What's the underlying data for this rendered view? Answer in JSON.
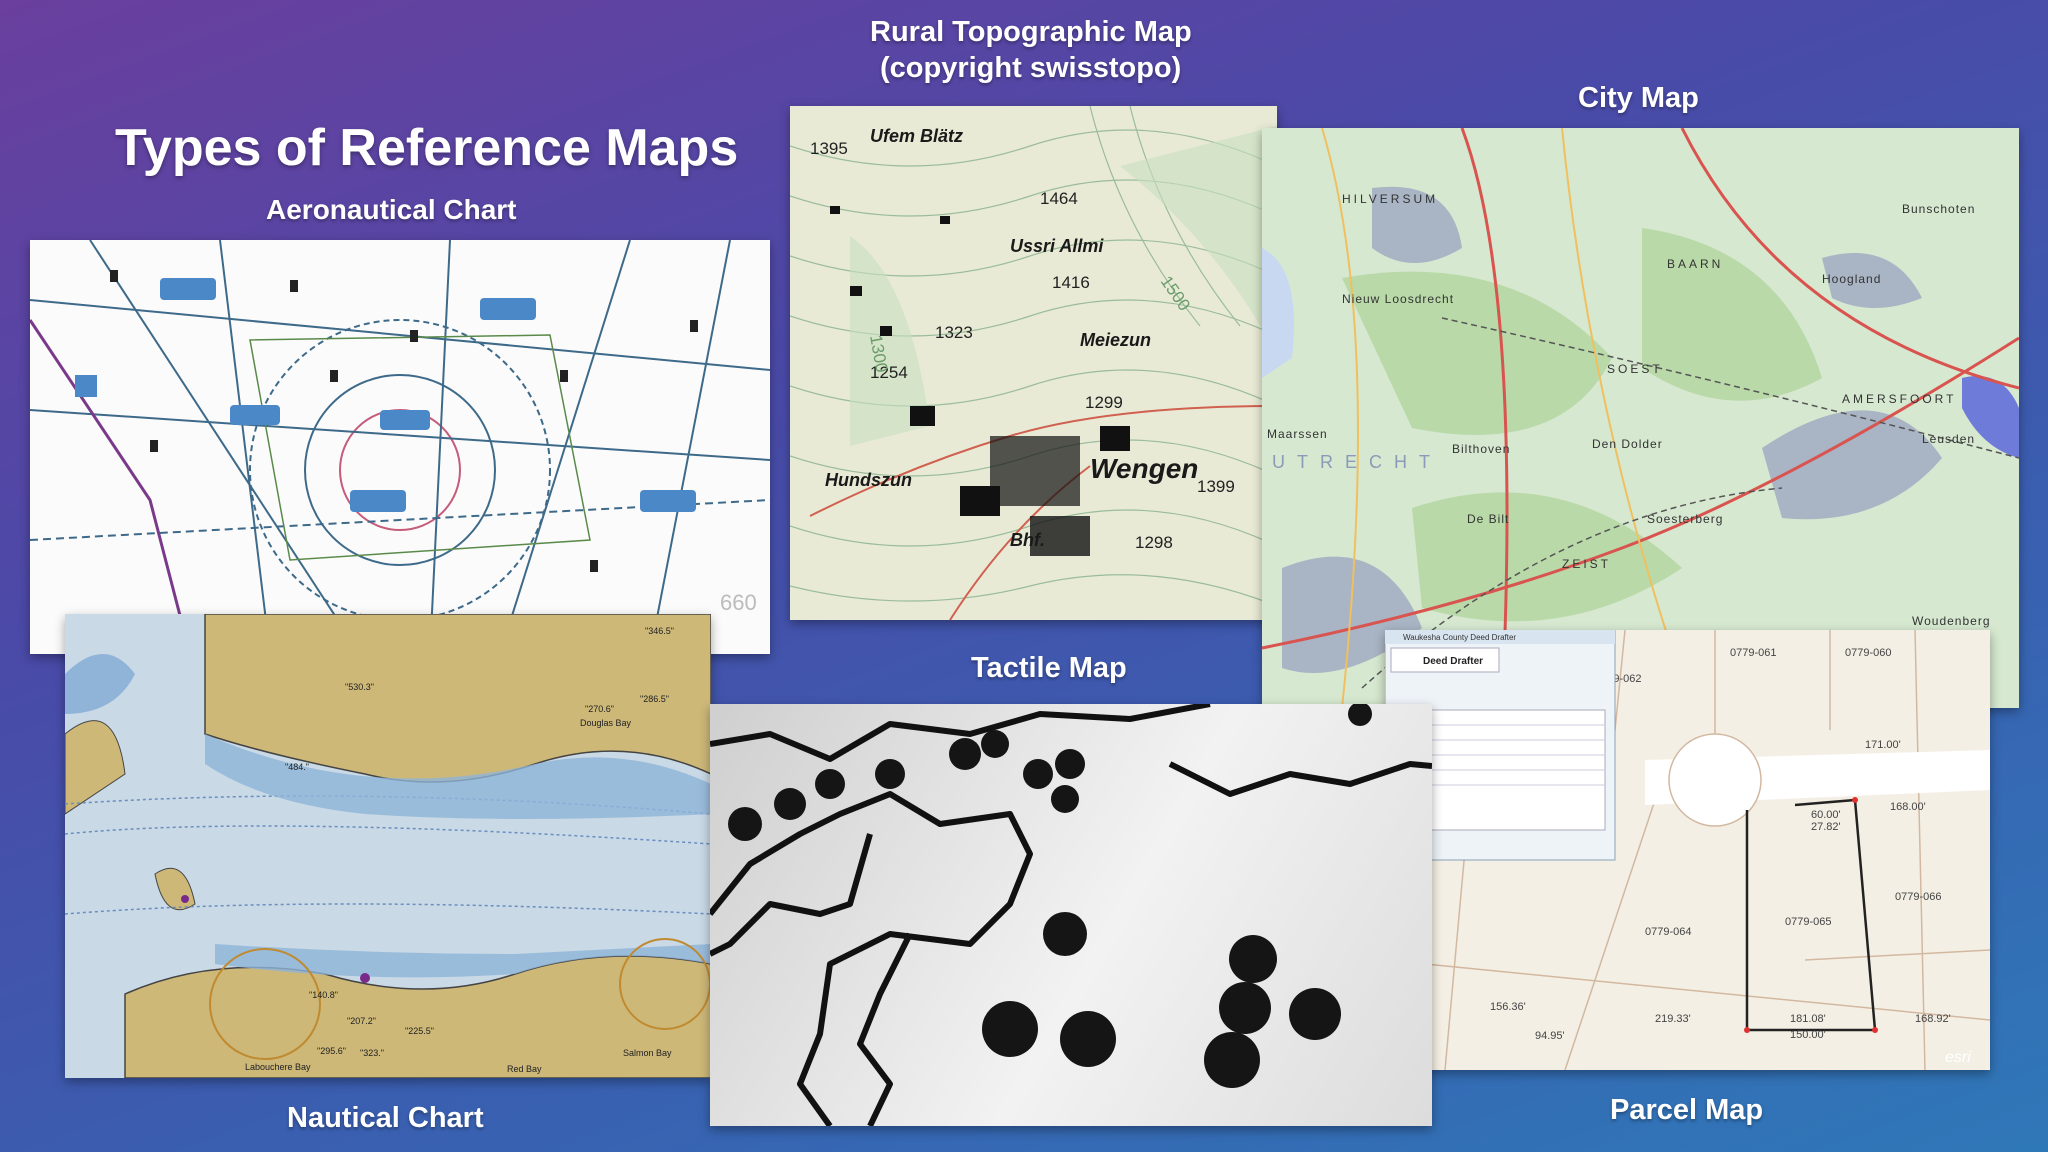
{
  "slide": {
    "title": "Types of Reference Maps",
    "colors": {
      "background_top": "#6a3f9e",
      "background_bottom": "#2f78b8",
      "text": "#ffffff"
    }
  },
  "maps": {
    "aeronautical": {
      "label": "Aeronautical Chart",
      "visible_numbers": [
        "660"
      ]
    },
    "topographic": {
      "label_line1": "Rural Topographic Map",
      "label_line2": "(copyright swisstopo)",
      "place_names": [
        "Ufem Blätz",
        "Ussri Allmi",
        "Meiezun",
        "Wengen",
        "Hundszun",
        "Bhf."
      ],
      "elevations": [
        "1395",
        "1464",
        "1416",
        "1323",
        "1254",
        "1299",
        "1399",
        "1298",
        "1300",
        "1500"
      ]
    },
    "city": {
      "label": "City Map",
      "place_names": [
        "HILVERSUM",
        "BAARN",
        "Bunschoten",
        "Hoogland",
        "AMERSFOORT",
        "Leusden",
        "Bilthoven",
        "De Bilt",
        "ZEIST",
        "SOEST",
        "Maarssen",
        "Den Dolder",
        "Soesterberg",
        "Woudenberg",
        "UTRECHT",
        "Nieuw Loosdrecht"
      ]
    },
    "tactile": {
      "label": "Tactile Map"
    },
    "nautical": {
      "label": "Nautical Chart",
      "soundings": [
        "\"530.3\"",
        "\"484.\"",
        "\"270.6\"",
        "\"286.5\"",
        "\"346.5\"",
        "\"140.8\"",
        "\"207.2\"",
        "\"225.5\"",
        "\"295.6\"",
        "\"323.\""
      ],
      "place_names": [
        "Douglas Bay",
        "Labouchere Bay",
        "Salmon Bay",
        "Red Bay"
      ]
    },
    "parcel": {
      "label": "Parcel Map",
      "window_title": "Waukesha County Deed Drafter",
      "panel_title": "Deed Drafter",
      "parcel_ids": [
        "0779-061",
        "0779-060",
        "0779-062",
        "0779-064",
        "0779-065",
        "0779-066"
      ],
      "dimensions": [
        "171.00'",
        "168.00'",
        "60.00'",
        "27.82'",
        "219.33'",
        "181.08'",
        "168.92'",
        "150.00'",
        "94.95'",
        "156.36'"
      ],
      "watermark": "esri"
    }
  }
}
